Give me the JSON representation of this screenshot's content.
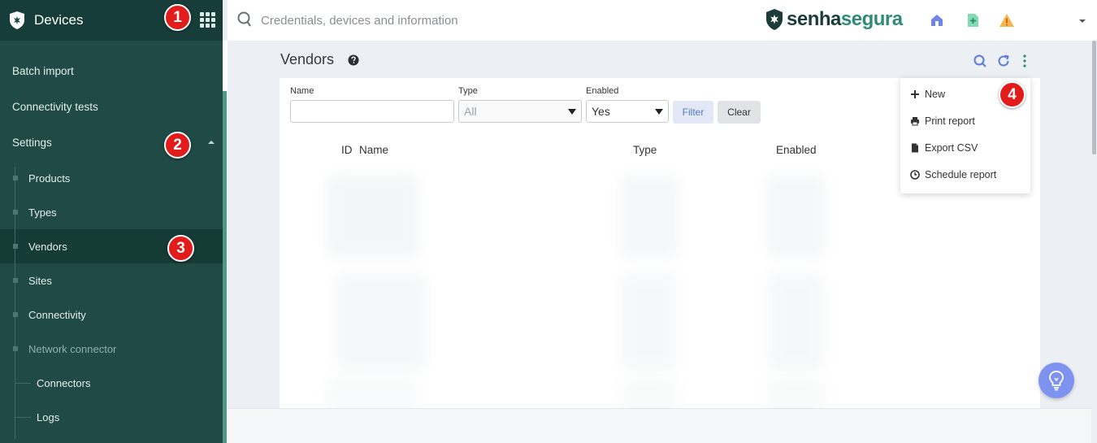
{
  "sidebar": {
    "title": "Devices",
    "items": [
      {
        "label": "Batch import"
      },
      {
        "label": "Connectivity tests"
      },
      {
        "label": "Settings"
      }
    ],
    "settings_children": [
      {
        "label": "Products"
      },
      {
        "label": "Types"
      },
      {
        "label": "Vendors"
      },
      {
        "label": "Sites"
      },
      {
        "label": "Connectivity"
      },
      {
        "label": "Network connector"
      }
    ],
    "network_connector_children": [
      {
        "label": "Connectors"
      },
      {
        "label": "Logs"
      }
    ]
  },
  "badges": [
    "1",
    "2",
    "3",
    "4"
  ],
  "topbar": {
    "search_placeholder": "Credentials, devices and information",
    "brand_part1": "senha",
    "brand_part2": "segura",
    "icons": [
      "home-icon",
      "add-file-icon",
      "warning-icon"
    ]
  },
  "page": {
    "title": "Vendors"
  },
  "filters": {
    "name_label": "Name",
    "name_value": "",
    "type_label": "Type",
    "type_value": "All",
    "enabled_label": "Enabled",
    "enabled_value": "Yes",
    "filter_button": "Filter",
    "clear_button": "Clear"
  },
  "table": {
    "columns": [
      "ID",
      "Name",
      "Type",
      "Enabled"
    ]
  },
  "menu": {
    "items": [
      {
        "label": "New",
        "icon": "plus-icon"
      },
      {
        "label": "Print report",
        "icon": "printer-icon"
      },
      {
        "label": "Export CSV",
        "icon": "file-icon"
      },
      {
        "label": "Schedule report",
        "icon": "clock-icon"
      }
    ]
  },
  "colors": {
    "sidebar_bg": "#1f4a46",
    "accent": "#2f8a78",
    "badge": "#e21b1b",
    "action_blue": "#5b7bd5"
  }
}
